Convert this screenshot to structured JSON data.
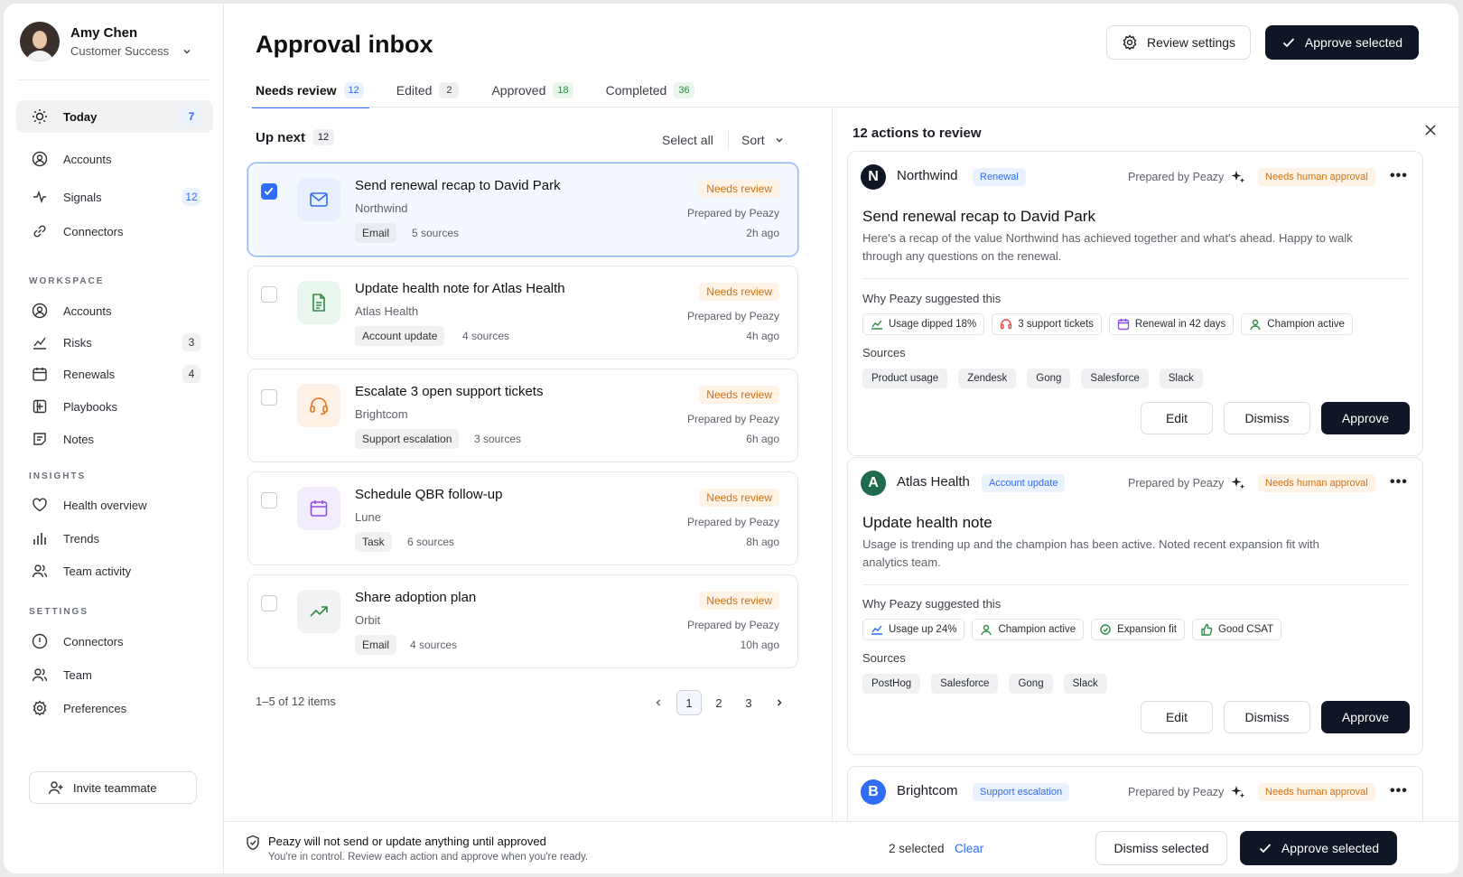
{
  "profile": {
    "name": "Amy Chen",
    "role": "Customer Success"
  },
  "nav": {
    "top": [
      {
        "label": "Today",
        "count": "7"
      },
      {
        "label": "Accounts",
        "count": ""
      },
      {
        "label": "Signals",
        "count": "12"
      },
      {
        "label": "Connectors",
        "count": ""
      }
    ],
    "workspace_label": "WORKSPACE",
    "workspace": [
      {
        "label": "Accounts",
        "count": ""
      },
      {
        "label": "Risks",
        "count": "3"
      },
      {
        "label": "Renewals",
        "count": "4"
      },
      {
        "label": "Playbooks",
        "count": ""
      },
      {
        "label": "Notes",
        "count": ""
      }
    ],
    "insights_label": "INSIGHTS",
    "insights": [
      {
        "label": "Health overview"
      },
      {
        "label": "Trends"
      },
      {
        "label": "Team activity"
      }
    ],
    "settings_label": "SETTINGS",
    "settings": [
      {
        "label": "Connectors"
      },
      {
        "label": "Team"
      },
      {
        "label": "Preferences"
      }
    ],
    "invite": "Invite teammate"
  },
  "header": {
    "title": "Approval inbox",
    "review_settings": "Review settings",
    "approve_selected": "Approve selected"
  },
  "tabs": [
    {
      "label": "Needs review",
      "count": "12"
    },
    {
      "label": "Edited",
      "count": "2"
    },
    {
      "label": "Approved",
      "count": "18"
    },
    {
      "label": "Completed",
      "count": "36"
    }
  ],
  "list": {
    "heading": "Up next",
    "count": "12",
    "select_all": "Select all",
    "sort": "Sort",
    "items": [
      {
        "title": "Send renewal recap to David Park",
        "org": "Northwind",
        "tag": "Email",
        "sources": "5 sources",
        "status": "Needs review",
        "prepared": "Prepared by Peazy",
        "ago": "2h ago",
        "checked": true
      },
      {
        "title": "Update health note for Atlas Health",
        "org": "Atlas Health",
        "tag": "Account update",
        "sources": "4 sources",
        "status": "Needs review",
        "prepared": "Prepared by Peazy",
        "ago": "4h ago",
        "checked": false
      },
      {
        "title": "Escalate 3 open support tickets",
        "org": "Brightcom",
        "tag": "Support escalation",
        "sources": "3 sources",
        "status": "Needs review",
        "prepared": "Prepared by Peazy",
        "ago": "6h ago",
        "checked": false
      },
      {
        "title": "Schedule QBR follow-up",
        "org": "Lune",
        "tag": "Task",
        "sources": "6 sources",
        "status": "Needs review",
        "prepared": "Prepared by Peazy",
        "ago": "8h ago",
        "checked": false
      },
      {
        "title": "Share adoption plan",
        "org": "Orbit",
        "tag": "Email",
        "sources": "4 sources",
        "status": "Needs review",
        "prepared": "Prepared by Peazy",
        "ago": "10h ago",
        "checked": false
      }
    ],
    "pagination": {
      "summary": "1–5 of 12 items",
      "pages": [
        "1",
        "2",
        "3"
      ]
    }
  },
  "detail": {
    "heading": "12 actions to review",
    "cards": [
      {
        "logo": "N",
        "name": "Northwind",
        "tag": "Renewal",
        "prepared": "Prepared by Peazy",
        "approval": "Needs human approval",
        "title": "Send renewal recap to David Park",
        "desc": "Here's a recap of the value Northwind has achieved together and what's ahead. Happy to walk through any questions on the renewal.",
        "why": "Why Peazy suggested this",
        "reasons": [
          "Usage dipped 18%",
          "3 support tickets",
          "Renewal in 42 days",
          "Champion active"
        ],
        "sources_label": "Sources",
        "sources": [
          "Product usage",
          "Zendesk",
          "Gong",
          "Salesforce",
          "Slack"
        ],
        "edit": "Edit",
        "dismiss": "Dismiss",
        "approve": "Approve"
      },
      {
        "logo": "A",
        "name": "Atlas Health",
        "tag": "Account update",
        "prepared": "Prepared by Peazy",
        "approval": "Needs human approval",
        "title": "Update health note",
        "desc": "Usage is trending up and the champion has been active. Noted recent expansion fit with analytics team.",
        "why": "Why Peazy suggested this",
        "reasons": [
          "Usage up 24%",
          "Champion active",
          "Expansion fit",
          "Good CSAT"
        ],
        "sources_label": "Sources",
        "sources": [
          "PostHog",
          "Salesforce",
          "Gong",
          "Slack"
        ],
        "edit": "Edit",
        "dismiss": "Dismiss",
        "approve": "Approve"
      },
      {
        "logo": "B",
        "name": "Brightcom",
        "tag": "Support escalation",
        "prepared": "Prepared by Peazy",
        "approval": "Needs human approval"
      }
    ]
  },
  "footer": {
    "notice": "Peazy will not send or update anything until approved",
    "sub": "You're in control. Review each action and approve when you're ready.",
    "selected": "2 selected",
    "clear": "Clear",
    "dismiss_selected": "Dismiss selected",
    "approve_selected": "Approve selected"
  },
  "colors": {
    "accent": "#2f6df6",
    "dark": "#0f1726",
    "warning": "#d4700c",
    "success": "#2e8b46"
  }
}
